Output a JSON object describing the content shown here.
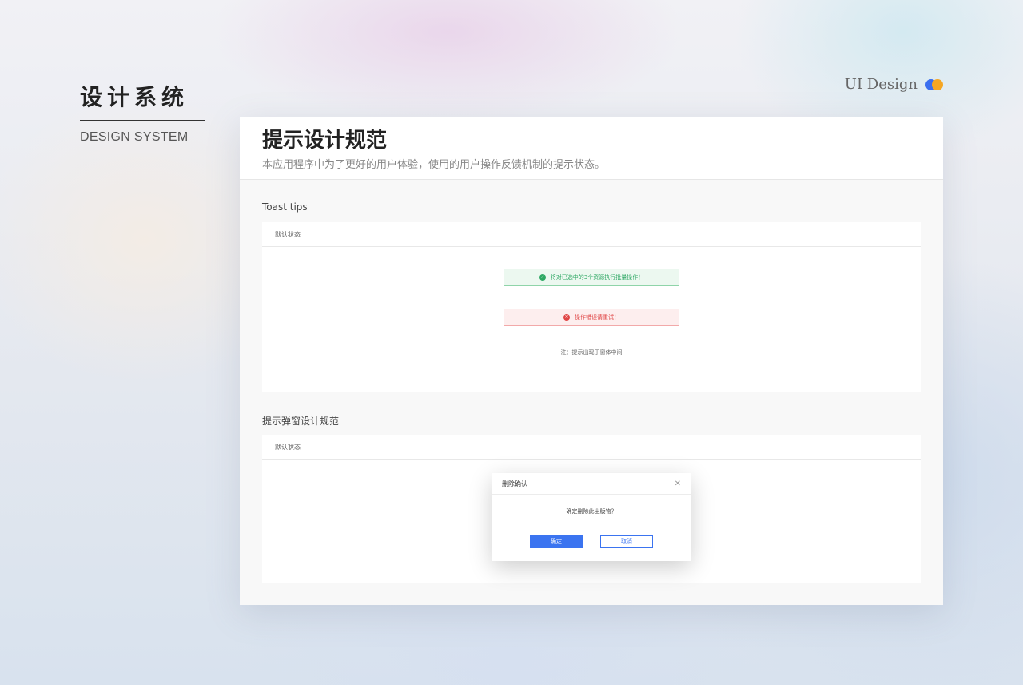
{
  "brand": {
    "title": "设计系统",
    "subtitle": "DESIGN SYSTEM"
  },
  "corner": {
    "label": "UI Design",
    "accent_blue": "#3b6fef",
    "accent_orange": "#f5a623"
  },
  "panel": {
    "title": "提示设计规范",
    "description": "本应用程序中为了更好的用户体验，使用的用户操作反馈机制的提示状态。"
  },
  "toast_section": {
    "label": "Toast tips",
    "card_header": "默认状态",
    "success": {
      "icon": "check-circle-icon",
      "text": "将对已选中的3个资源执行批量操作！",
      "color": "#2ea864"
    },
    "error": {
      "icon": "close-circle-icon",
      "text": "操作错误请重试！",
      "color": "#e04545"
    },
    "note": "注：提示出现于窗体中间"
  },
  "dialog_section": {
    "label": "提示弹窗设计规范",
    "card_header": "默认状态",
    "dialog": {
      "title": "删除确认",
      "close_icon": "close-icon",
      "message": "确定删除此出版物？",
      "confirm_label": "确定",
      "cancel_label": "取消",
      "primary_color": "#3b74f0"
    }
  }
}
